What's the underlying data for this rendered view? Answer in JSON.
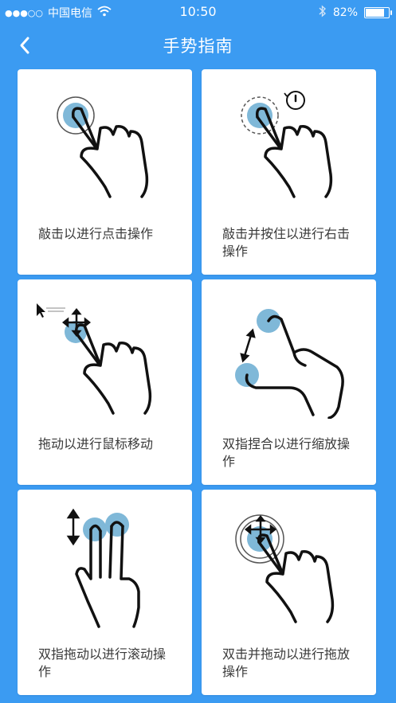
{
  "status_bar": {
    "signal_dots": "●●●○○",
    "carrier": "中国电信",
    "wifi_icon": "wifi-icon",
    "time": "10:50",
    "bluetooth_icon": "bluetooth-icon",
    "battery_percent": "82%",
    "battery_level": 0.82
  },
  "nav": {
    "back_icon": "chevron-left-icon",
    "title": "手势指南"
  },
  "colors": {
    "background": "#3b9bf2",
    "card": "#ffffff",
    "touch_dot": "#7fb8d8",
    "text": "#3a3a3a"
  },
  "gestures": [
    {
      "label": "敲击以进行点击操作",
      "icon": "tap-gesture-icon"
    },
    {
      "label": "敲击并按住以进行右击操作",
      "icon": "tap-and-hold-gesture-icon"
    },
    {
      "label": "拖动以进行鼠标移动",
      "icon": "drag-gesture-icon"
    },
    {
      "label": "双指捏合以进行缩放操作",
      "icon": "pinch-gesture-icon"
    },
    {
      "label": "双指拖动以进行滚动操作",
      "icon": "two-finger-scroll-gesture-icon"
    },
    {
      "label": "双击并拖动以进行拖放操作",
      "icon": "double-tap-drag-gesture-icon"
    }
  ]
}
